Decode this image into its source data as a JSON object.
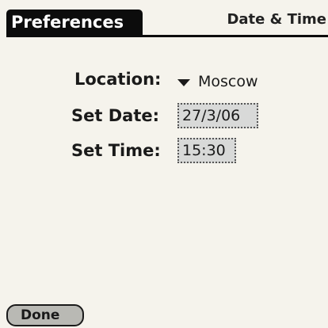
{
  "header": {
    "title": "Preferences",
    "panel": "Date & Time"
  },
  "form": {
    "location_label": "Location:",
    "location_value": "Moscow",
    "date_label": "Set Date:",
    "date_value": "27/3/06",
    "time_label": "Set Time:",
    "time_value": "15:30"
  },
  "footer": {
    "done_label": "Done"
  },
  "icons": {
    "location_trigger": "triangle-down-icon"
  },
  "colors": {
    "title_background": "#0c0c0c",
    "screen_background": "#f5f3ec",
    "selector_background": "#d8d9d8"
  }
}
